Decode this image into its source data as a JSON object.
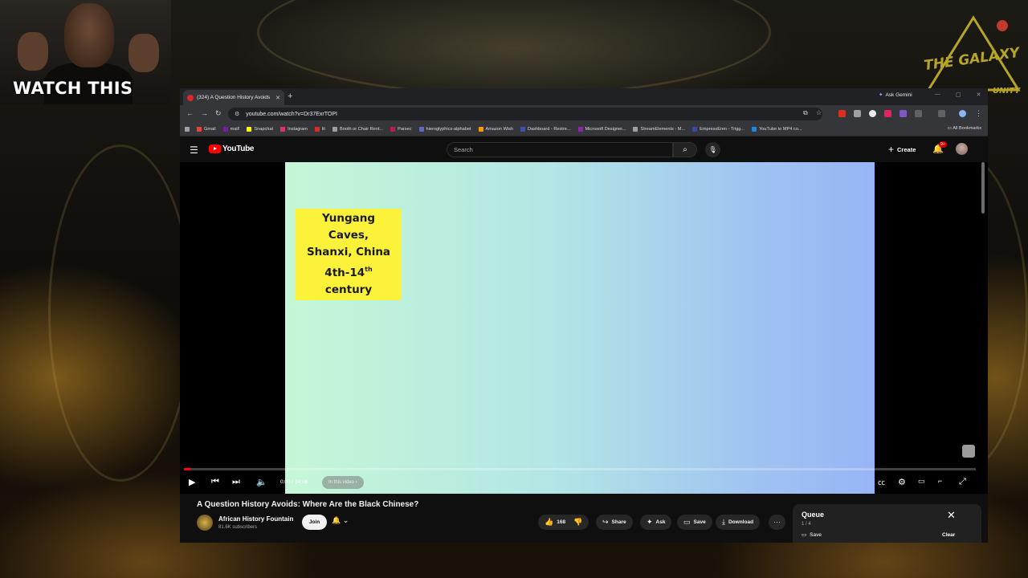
{
  "overlay": {
    "cam_label": "WATCH THIS",
    "logo_text": "THE GALAXY",
    "logo_sub": "UNITY"
  },
  "browser": {
    "tab_title": "(324) A Question History Avoids",
    "url": "youtube.com/watch?v=Dr37ExrTOPI",
    "gemini_label": "Ask Gemini",
    "all_bookmarks": "All Bookmarks",
    "bookmarks": [
      {
        "label": "Gmail",
        "color": "#ea4335"
      },
      {
        "label": "mail!",
        "color": "#7b1fa2"
      },
      {
        "label": "Snapchat",
        "color": "#fffc00"
      },
      {
        "label": "Instagram",
        "color": "#e1306c"
      },
      {
        "label": "lit",
        "color": "#d93025"
      },
      {
        "label": "Booth or Chair Rent...",
        "color": "#9aa0a6"
      },
      {
        "label": "Parsec",
        "color": "#c2185b"
      },
      {
        "label": "hieroglyphics-alphabet",
        "color": "#5c6bc0"
      },
      {
        "label": "Amazon Wish",
        "color": "#ff9900"
      },
      {
        "label": "Dashboard - Restre...",
        "color": "#3f51b5"
      },
      {
        "label": "Microsoft Designer...",
        "color": "#8e24aa"
      },
      {
        "label": "StreamElements - M...",
        "color": "#9aa0a6"
      },
      {
        "label": "EmpressEren - Trigg...",
        "color": "#3949ab"
      },
      {
        "label": "YouTube to MP4 co...",
        "color": "#1e88e5"
      }
    ]
  },
  "youtube": {
    "logo": "YouTube",
    "search_placeholder": "Search",
    "create_label": "Create",
    "notif_count": "9+"
  },
  "player": {
    "caption_line1": "Yungang Caves,",
    "caption_line2": "Shanxi, China",
    "caption_line3a": "4th-14",
    "caption_sup": "th",
    "caption_line3b": " century",
    "time": "0:00 / 14:06",
    "chapter": "In this video ›",
    "progress_fraction": 0.0
  },
  "video": {
    "title": "A Question History Avoids: Where Are the Black Chinese?",
    "channel": "African History Fountain",
    "subscribers": "81.6K subscribers",
    "join": "Join",
    "likes": "168",
    "share": "Share",
    "ask": "Ask",
    "save": "Save",
    "download": "Download"
  },
  "queue": {
    "title": "Queue",
    "count": "1 / 4",
    "save": "Save",
    "clear": "Clear"
  }
}
